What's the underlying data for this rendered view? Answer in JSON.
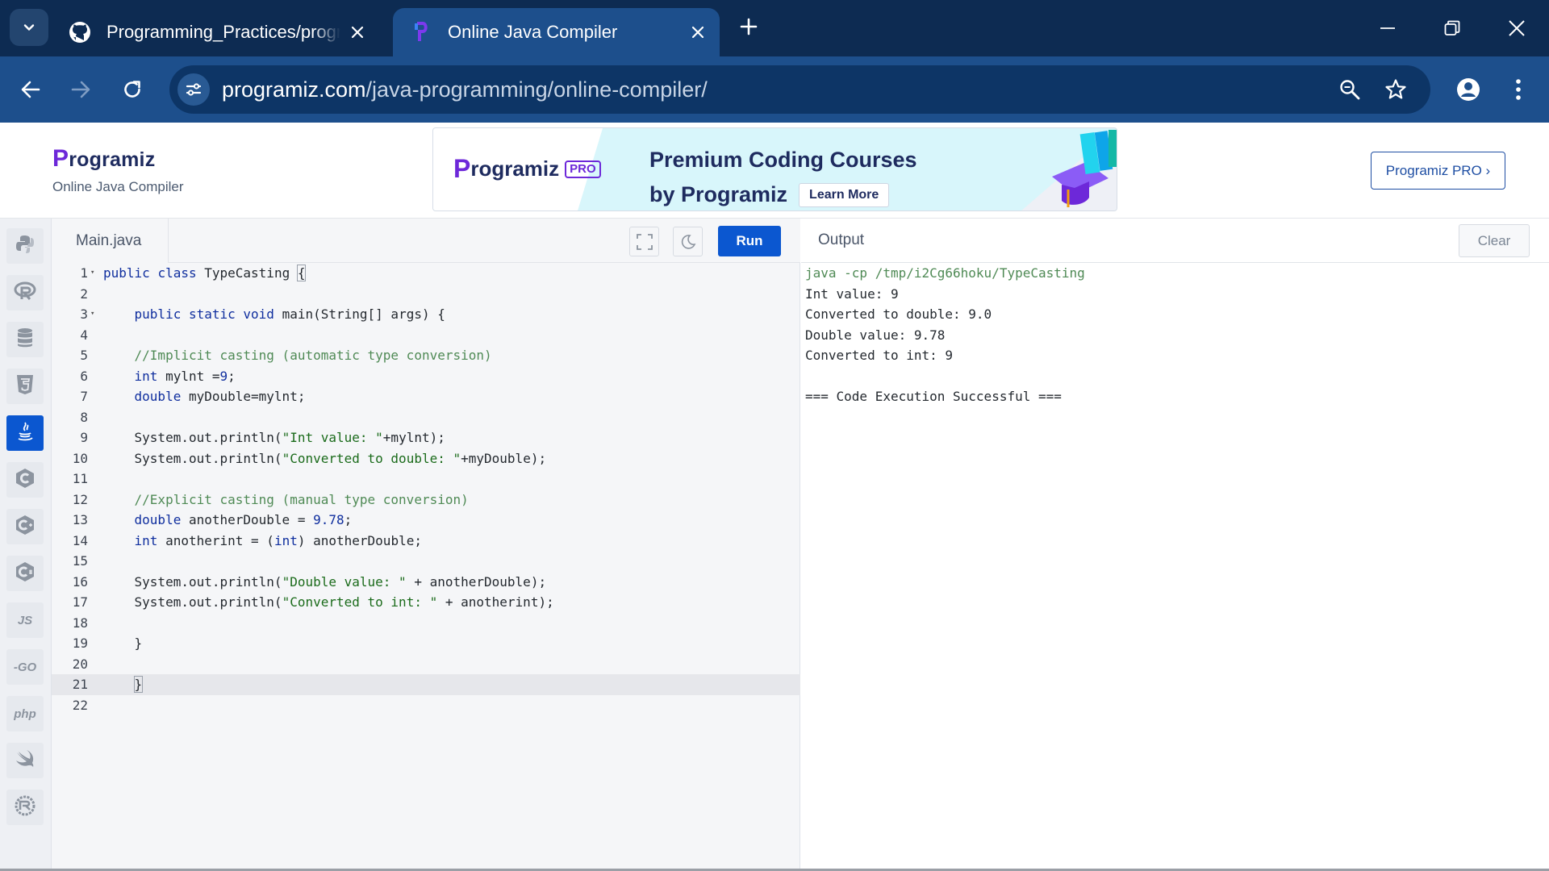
{
  "browser": {
    "tabs": [
      {
        "title": "Programming_Practices/programming",
        "active": false,
        "icon": "github-icon"
      },
      {
        "title": "Online Java Compiler",
        "active": true,
        "icon": "programiz-icon"
      }
    ],
    "url_host": "programiz.com",
    "url_path": "/java-programming/online-compiler/"
  },
  "header": {
    "brand_logo": "rogramiz",
    "brand_subtitle": "Online Java Compiler",
    "ad": {
      "logo": "rogramiz",
      "logo_badge": "PRO",
      "title_line1": "Premium Coding Courses",
      "title_line2": "by Programiz",
      "cta": "Learn More"
    },
    "pro_button": "Programiz PRO ›"
  },
  "languages": [
    {
      "name": "python-icon",
      "label": "",
      "active": false
    },
    {
      "name": "r-icon",
      "label": "",
      "active": false
    },
    {
      "name": "sql-icon",
      "label": "",
      "active": false
    },
    {
      "name": "html-icon",
      "label": "",
      "active": false
    },
    {
      "name": "java-icon",
      "label": "",
      "active": true
    },
    {
      "name": "c-icon",
      "label": "",
      "active": false
    },
    {
      "name": "cpp-icon",
      "label": "",
      "active": false
    },
    {
      "name": "csharp-icon",
      "label": "",
      "active": false
    },
    {
      "name": "js-icon",
      "label": "JS",
      "active": false
    },
    {
      "name": "go-icon",
      "label": "-GO",
      "active": false
    },
    {
      "name": "php-icon",
      "label": "php",
      "active": false
    },
    {
      "name": "swift-icon",
      "label": "",
      "active": false
    },
    {
      "name": "rust-icon",
      "label": "",
      "active": false
    }
  ],
  "editor": {
    "file_name": "Main.java",
    "run_label": "Run",
    "active_line": 21,
    "lines": [
      [
        {
          "t": "kw",
          "v": "public"
        },
        {
          "t": "",
          "v": " "
        },
        {
          "t": "kw",
          "v": "class"
        },
        {
          "t": "",
          "v": " TypeCasting "
        },
        {
          "t": "bx",
          "v": "{"
        }
      ],
      [],
      [
        {
          "t": "",
          "v": "    "
        },
        {
          "t": "kw",
          "v": "public"
        },
        {
          "t": "",
          "v": " "
        },
        {
          "t": "kw",
          "v": "static"
        },
        {
          "t": "",
          "v": " "
        },
        {
          "t": "kw",
          "v": "void"
        },
        {
          "t": "",
          "v": " main(String[] args) {"
        }
      ],
      [],
      [
        {
          "t": "",
          "v": "    "
        },
        {
          "t": "cm",
          "v": "//Implicit casting (automatic type conversion)"
        }
      ],
      [
        {
          "t": "",
          "v": "    "
        },
        {
          "t": "kw",
          "v": "int"
        },
        {
          "t": "",
          "v": " mylnt ="
        },
        {
          "t": "nm",
          "v": "9"
        },
        {
          "t": "",
          "v": ";"
        }
      ],
      [
        {
          "t": "",
          "v": "    "
        },
        {
          "t": "kw",
          "v": "double"
        },
        {
          "t": "",
          "v": " myDouble=mylnt;"
        }
      ],
      [],
      [
        {
          "t": "",
          "v": "    System.out.println("
        },
        {
          "t": "st",
          "v": "\"Int value: \""
        },
        {
          "t": "",
          "v": "+mylnt);"
        }
      ],
      [
        {
          "t": "",
          "v": "    System.out.println("
        },
        {
          "t": "st",
          "v": "\"Converted to double: \""
        },
        {
          "t": "",
          "v": "+myDouble);"
        }
      ],
      [],
      [
        {
          "t": "",
          "v": "    "
        },
        {
          "t": "cm",
          "v": "//Explicit casting (manual type conversion)"
        }
      ],
      [
        {
          "t": "",
          "v": "    "
        },
        {
          "t": "kw",
          "v": "double"
        },
        {
          "t": "",
          "v": " anotherDouble = "
        },
        {
          "t": "nm",
          "v": "9.78"
        },
        {
          "t": "",
          "v": ";"
        }
      ],
      [
        {
          "t": "",
          "v": "    "
        },
        {
          "t": "kw",
          "v": "int"
        },
        {
          "t": "",
          "v": " anotherint = ("
        },
        {
          "t": "kw",
          "v": "int"
        },
        {
          "t": "",
          "v": ") anotherDouble;"
        }
      ],
      [],
      [
        {
          "t": "",
          "v": "    System.out.println("
        },
        {
          "t": "st",
          "v": "\"Double value: \""
        },
        {
          "t": "",
          "v": " + anotherDouble);"
        }
      ],
      [
        {
          "t": "",
          "v": "    System.out.println("
        },
        {
          "t": "st",
          "v": "\"Converted to int: \""
        },
        {
          "t": "",
          "v": " + anotherint);"
        }
      ],
      [],
      [
        {
          "t": "",
          "v": "    }"
        }
      ],
      [],
      [
        {
          "t": "",
          "v": "    "
        },
        {
          "t": "bx",
          "v": "}"
        }
      ],
      []
    ]
  },
  "output": {
    "title": "Output",
    "clear_label": "Clear",
    "command": "java -cp /tmp/i2Cg66hoku/TypeCasting",
    "lines": [
      "Int value: 9",
      "Converted to double: 9.0",
      "Double value: 9.78",
      "Converted to int: 9",
      "",
      "=== Code Execution Successful ==="
    ]
  }
}
